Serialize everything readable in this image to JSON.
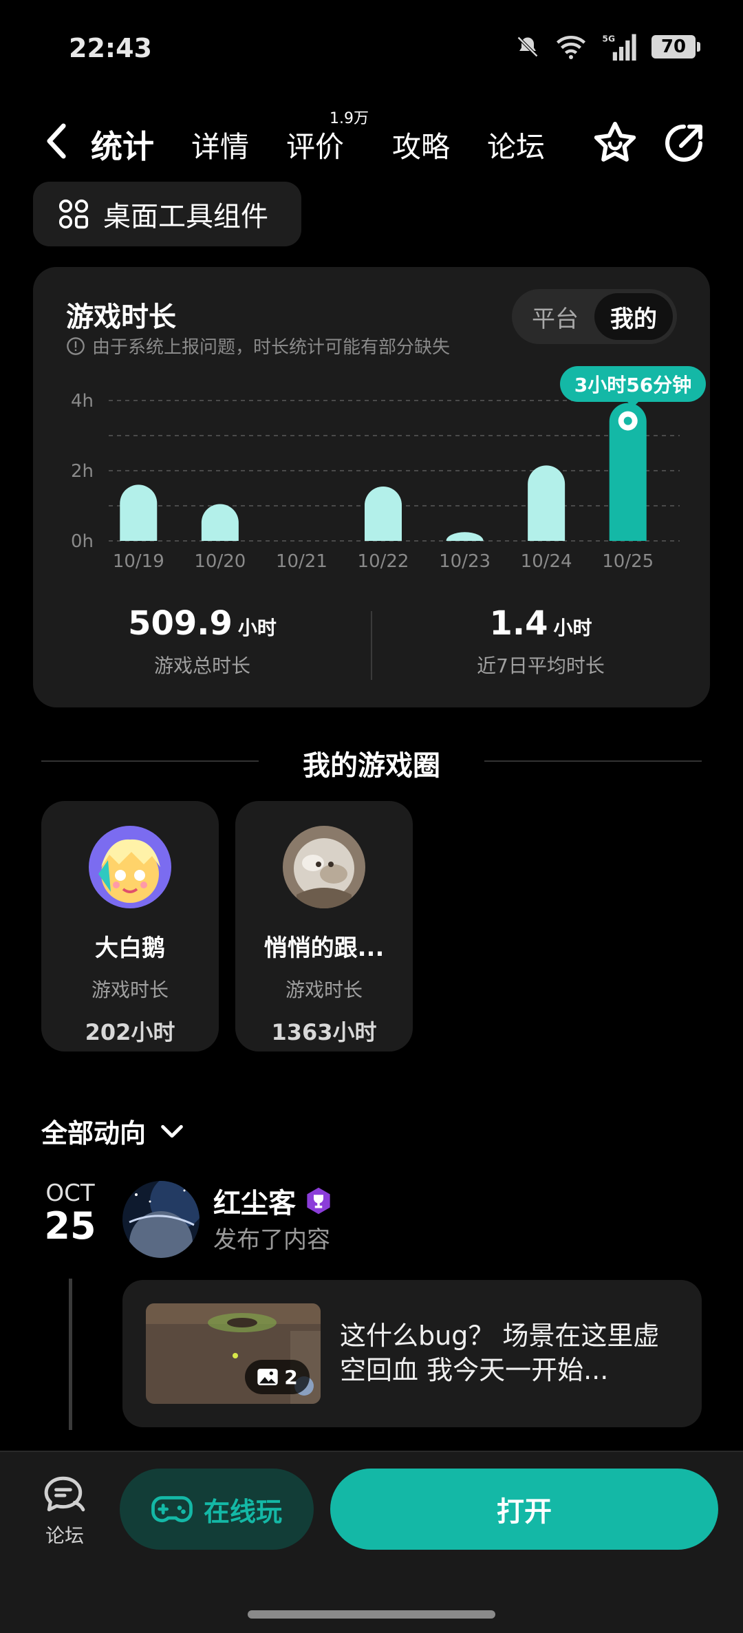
{
  "status_bar": {
    "time": "22:43",
    "battery": "70",
    "network": "5G"
  },
  "nav": {
    "tabs": [
      {
        "label": "统计",
        "active": true
      },
      {
        "label": "详情",
        "active": false
      },
      {
        "label": "评价",
        "active": false,
        "badge": "1.9万"
      },
      {
        "label": "攻略",
        "active": false
      },
      {
        "label": "论坛",
        "active": false
      }
    ],
    "icons": {
      "back": "back-arrow-icon",
      "favorite": "star-icon",
      "share": "share-icon"
    }
  },
  "widget_button": {
    "label": "桌面工具组件"
  },
  "playtime": {
    "title": "游戏时长",
    "note": "由于系统上报问题，时长统计可能有部分缺失",
    "toggle": {
      "options": [
        "平台",
        "我的"
      ],
      "selected": "我的"
    },
    "tooltip": "3小时56分钟",
    "total": {
      "value": "509.9",
      "unit": "小时",
      "label": "游戏总时长"
    },
    "average": {
      "value": "1.4",
      "unit": "小时",
      "label": "近7日平均时长"
    }
  },
  "chart_data": {
    "type": "bar",
    "categories": [
      "10/19",
      "10/20",
      "10/21",
      "10/22",
      "10/23",
      "10/24",
      "10/25"
    ],
    "values": [
      1.6,
      1.05,
      0,
      1.55,
      0.25,
      2.15,
      3.93
    ],
    "yticks": [
      "0h",
      "2h",
      "4h"
    ],
    "ylim": [
      0,
      4
    ],
    "highlight_index": 6,
    "colors": {
      "bar": "#b3f0ea",
      "highlight": "#14b8a6"
    },
    "grid": true
  },
  "circle": {
    "title": "我的游戏圈",
    "friends": [
      {
        "name": "大白鹅",
        "label": "游戏时长",
        "hours": "202小时"
      },
      {
        "name": "悄悄的跟...",
        "label": "游戏时长",
        "hours": "1363小时"
      }
    ]
  },
  "feed": {
    "filter": "全部动向",
    "date": {
      "month": "OCT",
      "day": "25"
    },
    "post": {
      "user": "红尘客",
      "action": "发布了内容",
      "image_count": "2",
      "text": "这什么bug？ 场景在这里虚空回血 我今天一开始..."
    }
  },
  "bottom_bar": {
    "forum_label": "论坛",
    "online_label": "在线玩",
    "open_label": "打开"
  },
  "colors": {
    "accent": "#14b8a6",
    "card": "#1c1c1c",
    "background": "#000000"
  }
}
